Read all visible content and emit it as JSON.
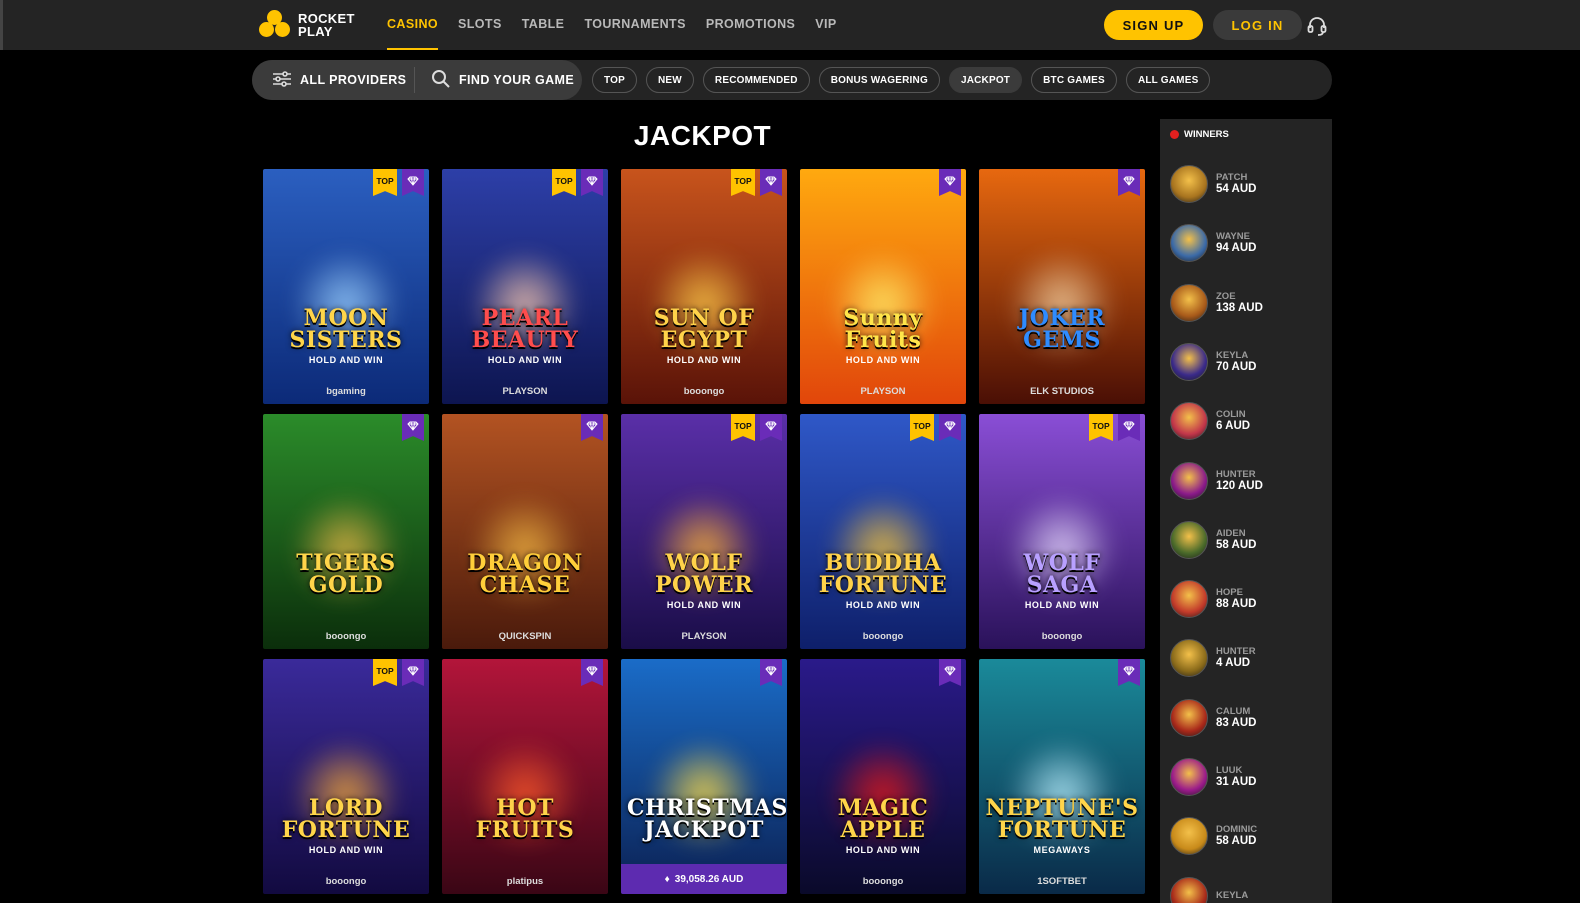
{
  "header": {
    "logo_line1": "ROCKET",
    "logo_line2": "PLAY",
    "nav": [
      "CASINO",
      "SLOTS",
      "TABLE",
      "TOURNAMENTS",
      "PROMOTIONS",
      "VIP"
    ],
    "active_nav": "CASINO",
    "signup_label": "SIGN UP",
    "login_label": "LOG IN",
    "support_icon": "headset-icon"
  },
  "filters": {
    "providers_label": "ALL PROVIDERS",
    "find_label": "FIND YOUR GAME",
    "chips": [
      "TOP",
      "NEW",
      "RECOMMENDED",
      "BONUS WAGERING",
      "JACKPOT",
      "BTC GAMES",
      "ALL GAMES"
    ],
    "active_chip": "JACKPOT"
  },
  "page": {
    "title": "JACKPOT"
  },
  "colors": {
    "accent": "#ffc300",
    "gem_badge": "#6a2cb8",
    "bg": "#000000",
    "panel": "#242424"
  },
  "games": [
    {
      "title": "MOON SISTERS",
      "sub": "HOLD AND WIN",
      "provider": "bgaming",
      "top": true,
      "bg": [
        "#2b5fc0",
        "#0c2a78"
      ],
      "glow": "#9ad0ff",
      "title_color": "#ffd54a"
    },
    {
      "title": "PEARL BEAUTY",
      "sub": "HOLD AND WIN",
      "provider": "PLAYSON",
      "top": true,
      "bg": [
        "#2d3fa8",
        "#0d1550"
      ],
      "glow": "#f7c8b0",
      "title_color": "#ff4d4d"
    },
    {
      "title": "SUN OF EGYPT",
      "sub": "HOLD AND WIN",
      "provider": "booongo",
      "top": true,
      "bg": [
        "#c8541c",
        "#5a1308"
      ],
      "glow": "#ffcc4a",
      "title_color": "#ffd34a"
    },
    {
      "title": "Sunny Fruits",
      "sub": "HOLD AND WIN",
      "provider": "PLAYSON",
      "top": false,
      "bg": [
        "#ffa90f",
        "#e1460b"
      ],
      "glow": "#fff16b",
      "title_color": "#ffe54a"
    },
    {
      "title": "JOKER GEMS",
      "sub": "",
      "provider": "ELK STUDIOS",
      "top": false,
      "bg": [
        "#e7680f",
        "#4a0f05"
      ],
      "glow": "#f5d1a0",
      "title_color": "#2f8cff"
    },
    {
      "title": "TIGERS GOLD",
      "sub": "",
      "provider": "booongo",
      "top": false,
      "bg": [
        "#2b8c2a",
        "#0b2e0b"
      ],
      "glow": "#e6b847",
      "title_color": "#ffd54a"
    },
    {
      "title": "DRAGON CHASE",
      "sub": "",
      "provider": "QUICKSPIN",
      "top": false,
      "bg": [
        "#b35322",
        "#4a1a0b"
      ],
      "glow": "#f2b643",
      "title_color": "#ffcf3a"
    },
    {
      "title": "WOLF POWER",
      "sub": "HOLD AND WIN",
      "provider": "PLAYSON",
      "top": true,
      "bg": [
        "#5a2fa8",
        "#1a0d48"
      ],
      "glow": "#ffb33a",
      "title_color": "#ffd34a"
    },
    {
      "title": "BUDDHA FORTUNE",
      "sub": "HOLD AND WIN",
      "provider": "booongo",
      "top": true,
      "bg": [
        "#2f58c8",
        "#0e1f6a"
      ],
      "glow": "#f8c63a",
      "title_color": "#ffd24a"
    },
    {
      "title": "WOLF SAGA",
      "sub": "HOLD AND WIN",
      "provider": "booongo",
      "top": true,
      "bg": [
        "#8a4ed6",
        "#2a125a"
      ],
      "glow": "#e7d9ff",
      "title_color": "#b8a0ff"
    },
    {
      "title": "LORD FORTUNE",
      "sub": "HOLD AND WIN",
      "provider": "booongo",
      "top": true,
      "bg": [
        "#3a2a9a",
        "#120a40"
      ],
      "glow": "#f5a83a",
      "title_color": "#ffd54a"
    },
    {
      "title": "HOT FRUITS",
      "sub": "",
      "provider": "platipus",
      "top": false,
      "bg": [
        "#b3153a",
        "#3a0615"
      ],
      "glow": "#ff5a2a",
      "title_color": "#ffd24a"
    },
    {
      "title": "CHRISTMAS JACKPOT",
      "sub": "",
      "provider": "",
      "top": false,
      "bg": [
        "#1a6cc8",
        "#0b2052"
      ],
      "glow": "#ffdf4a",
      "title_color": "#ffffff",
      "jackpot": "39,058.26 AUD"
    },
    {
      "title": "MAGIC APPLE",
      "sub": "HOLD AND WIN",
      "provider": "booongo",
      "top": false,
      "bg": [
        "#2a1a8a",
        "#0a0a2a"
      ],
      "glow": "#e81a1a",
      "title_color": "#ffd54a"
    },
    {
      "title": "NEPTUNE'S FORTUNE",
      "sub": "MEGAWAYS",
      "provider": "1SOFTBET",
      "top": false,
      "bg": [
        "#1a8a9a",
        "#0a2a48"
      ],
      "glow": "#b8f0ff",
      "title_color": "#ffd54a"
    }
  ],
  "winners": {
    "label": "WINNERS",
    "items": [
      {
        "name": "PATCH",
        "amount": "54 AUD",
        "color": "#a8741f"
      },
      {
        "name": "WAYNE",
        "amount": "94 AUD",
        "color": "#3b6aa8"
      },
      {
        "name": "ZOE",
        "amount": "138 AUD",
        "color": "#a85a1a"
      },
      {
        "name": "KEYLA",
        "amount": "70 AUD",
        "color": "#3a2a8a"
      },
      {
        "name": "COLIN",
        "amount": "6 AUD",
        "color": "#c2364a"
      },
      {
        "name": "HUNTER",
        "amount": "120 AUD",
        "color": "#8a1a8a"
      },
      {
        "name": "AIDEN",
        "amount": "58 AUD",
        "color": "#4a6a2a"
      },
      {
        "name": "HOPE",
        "amount": "88 AUD",
        "color": "#c23a2a"
      },
      {
        "name": "HUNTER",
        "amount": "4 AUD",
        "color": "#8a6a1a"
      },
      {
        "name": "CALUM",
        "amount": "83 AUD",
        "color": "#a8281a"
      },
      {
        "name": "LUUK",
        "amount": "31 AUD",
        "color": "#9a1a8a"
      },
      {
        "name": "DOMINIC",
        "amount": "58 AUD",
        "color": "#c88a1a"
      },
      {
        "name": "KEYLA",
        "amount": "",
        "color": "#a82a1a"
      }
    ]
  }
}
